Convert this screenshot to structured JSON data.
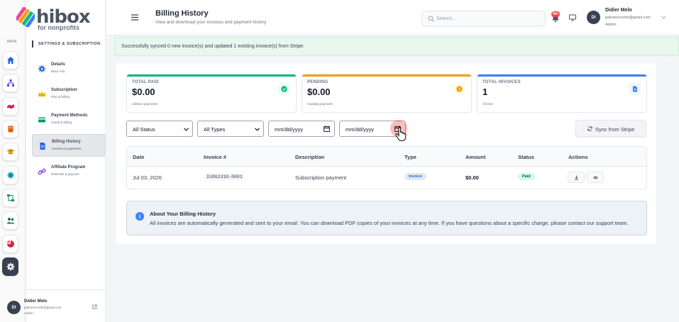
{
  "rail": {
    "main_label": "MAIN",
    "items": [
      {
        "icon": "home-icon",
        "color": "#2563eb"
      },
      {
        "icon": "sitemap-icon",
        "color": "#4f46e5"
      },
      {
        "icon": "handshake-icon",
        "color": "#e11d48"
      },
      {
        "icon": "book-icon",
        "color": "#ea580c"
      },
      {
        "icon": "graduation-cap-icon",
        "color": "#ca8a04"
      },
      {
        "icon": "virus-icon",
        "color": "#0891b2"
      },
      {
        "icon": "diagram-icon",
        "color": "#059669"
      },
      {
        "icon": "users-icon",
        "color": "#047857"
      },
      {
        "icon": "pie-chart-icon",
        "color": "#e11d48"
      },
      {
        "icon": "settings-icon",
        "color": "#ffffff"
      }
    ]
  },
  "logo": {
    "text": "hibox",
    "sub": "for nonprofits"
  },
  "sidebar": {
    "section": "SETTINGS & SUBSCRIPTION",
    "items": [
      {
        "title": "Details",
        "sub": "Basic info",
        "icon": "gear-icon"
      },
      {
        "title": "Subscription",
        "sub": "Plan & billing",
        "icon": "crown-icon"
      },
      {
        "title": "Payment Methods",
        "sub": "Cards & billing",
        "icon": "credit-card-icon"
      },
      {
        "title": "Billing History",
        "sub": "Invoices & payments",
        "icon": "invoice-icon"
      },
      {
        "title": "Affiliate Program",
        "sub": "Referrals & payouts",
        "icon": "link-icon"
      }
    ],
    "profile": {
      "initials": "DI",
      "name": "Didier Melo",
      "email": "palmerecordz@gmail.com",
      "role": "Admin"
    }
  },
  "header": {
    "title": "Billing History",
    "subtitle": "View and download your invoices and payment history",
    "search_placeholder": "Search...",
    "notification_badge": "99+",
    "user": {
      "initials": "DI",
      "name": "Didier Melo",
      "email": "palmerecordz@gmail.com",
      "role": "Admin"
    }
  },
  "alert": {
    "text": "Successfully synced 0 new invoice(s) and updated 1 existing invoice(s) from Stripe."
  },
  "stats": [
    {
      "label": "TOTAL PAID",
      "value": "$0.00",
      "sub": "Lifetime payments",
      "color": "#10b981"
    },
    {
      "label": "PENDING",
      "value": "$0.00",
      "sub": "Awaiting payment",
      "color": "#f59e0b"
    },
    {
      "label": "TOTAL INVOICES",
      "value": "1",
      "sub": "All time",
      "color": "#3b82f6"
    }
  ],
  "filters": {
    "status": "All Status",
    "type": "All Types",
    "date_from": "mm/dd/yyyy",
    "date_to": "mm/dd/yyyy",
    "sync_label": "Sync from Stripe"
  },
  "table": {
    "headers": [
      "Date",
      "Invoice #",
      "Description",
      "Type",
      "Amount",
      "Status",
      "Actions"
    ],
    "rows": [
      {
        "date": "Jul 03, 2026",
        "invoice": "IUOG231G-0001",
        "description": "Subscription payment",
        "type": "Invoice",
        "amount": "$0.00",
        "status": "Paid"
      }
    ]
  },
  "info": {
    "title": "About Your Billing History",
    "text": "All invoices are automatically generated and sent to your email. You can download PDF copies of your invoices at any time. If you have questions about a specific charge, please contact our support team."
  }
}
